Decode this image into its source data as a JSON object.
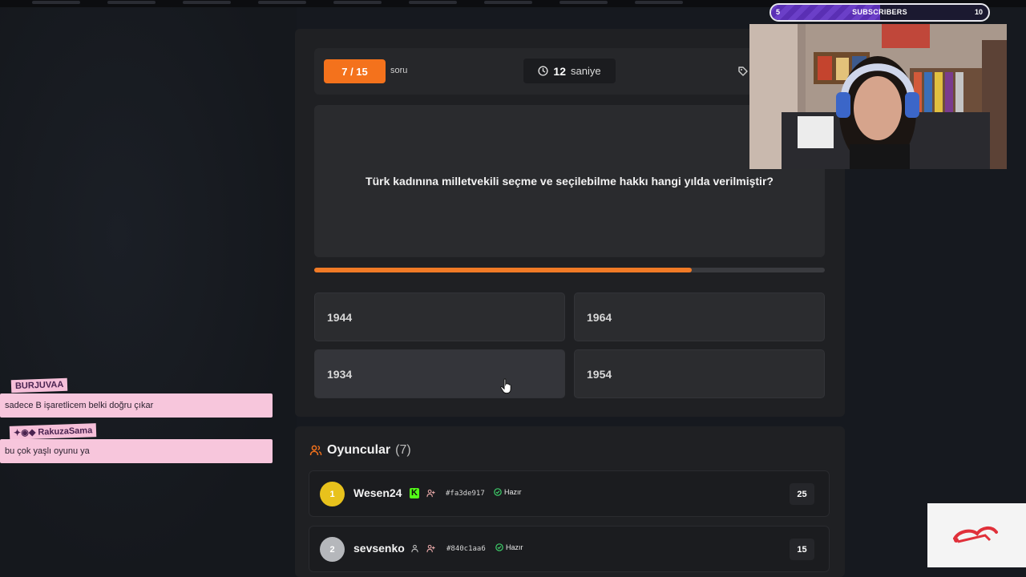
{
  "quiz": {
    "question_counter": "7 / 15",
    "counter_suffix": "soru",
    "timer_value": "12",
    "timer_unit": "saniye",
    "question": "Türk kadınına milletvekili seçme ve seçilebilme hakkı hangi yılda verilmiştir?",
    "time_progress_percent": 74,
    "answers": [
      "1944",
      "1964",
      "1934",
      "1954"
    ]
  },
  "players": {
    "title": "Oyuncular",
    "count": "(7)",
    "rows": [
      {
        "rank": "1",
        "name": "Wesen24",
        "id": "#fa3de917",
        "status": "Hazır",
        "score": "25"
      },
      {
        "rank": "2",
        "name": "sevsenko",
        "id": "#840c1aa6",
        "status": "Hazır",
        "score": "15"
      }
    ]
  },
  "overlay": {
    "subs_label": "SUBSCRIBERS",
    "subs_current": "5",
    "subs_goal": "10",
    "subs_fill_fraction": 0.5
  },
  "chat": [
    {
      "user": "BURJUVAA",
      "message": "sadece B işaretlicem belki doğru çıkar"
    },
    {
      "user": "RakuzaSama",
      "message": "bu çok yaşlı oyunu ya"
    }
  ],
  "colors": {
    "accent": "#f4721c",
    "ready": "#3ecf6a",
    "gold": "#e8c21c",
    "kick_green": "#53fc18"
  }
}
